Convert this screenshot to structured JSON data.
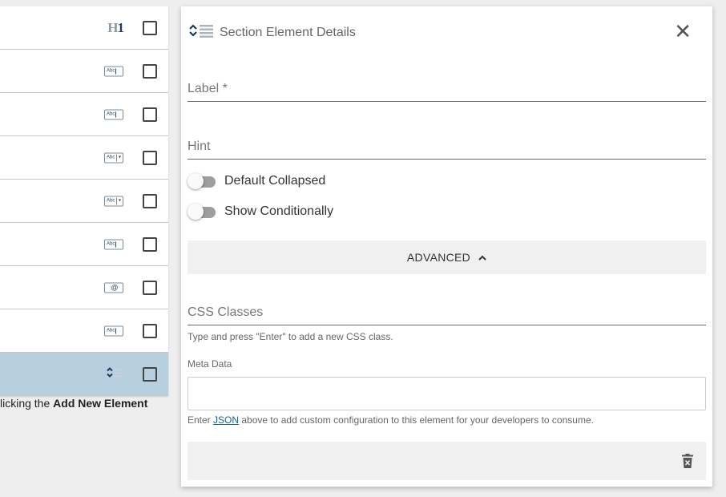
{
  "list": {
    "rows": [
      {
        "icon": "heading-icon",
        "icon_text_a": "H",
        "icon_text_b": "1",
        "selected": false
      },
      {
        "icon": "text-field-icon",
        "icon_text": "Abc",
        "selected": false
      },
      {
        "icon": "text-field-icon",
        "icon_text": "Abc",
        "selected": false
      },
      {
        "icon": "dropdown-field-icon",
        "icon_text": "Abc",
        "selected": false
      },
      {
        "icon": "dropdown-field-icon",
        "icon_text": "Abc",
        "selected": false
      },
      {
        "icon": "text-field-icon",
        "icon_text": "Abc",
        "selected": false
      },
      {
        "icon": "email-field-icon",
        "icon_text": "@",
        "selected": false
      },
      {
        "icon": "text-field-icon",
        "icon_text": "Abc",
        "selected": false
      },
      {
        "icon": "section-icon",
        "selected": true
      }
    ],
    "footer_prefix": "licking the ",
    "footer_bold": "Add New Element"
  },
  "panel": {
    "title": "Section Element Details",
    "label_placeholder": "Label *",
    "hint_placeholder": "Hint",
    "toggle_default_collapsed": "Default Collapsed",
    "toggle_show_conditionally": "Show Conditionally",
    "advanced_label": "ADVANCED",
    "css_classes_placeholder": "CSS Classes",
    "css_hint": "Type and press \"Enter\" to add a new CSS class.",
    "meta_label": "Meta Data",
    "meta_hint_prefix": "Enter ",
    "meta_hint_link": "JSON",
    "meta_hint_suffix": " above to add custom configuration to this element for your developers to consume."
  },
  "colors": {
    "selected_row": "#b7cfdf",
    "accent": "#1d3b5c",
    "link": "#1a5f8a"
  }
}
